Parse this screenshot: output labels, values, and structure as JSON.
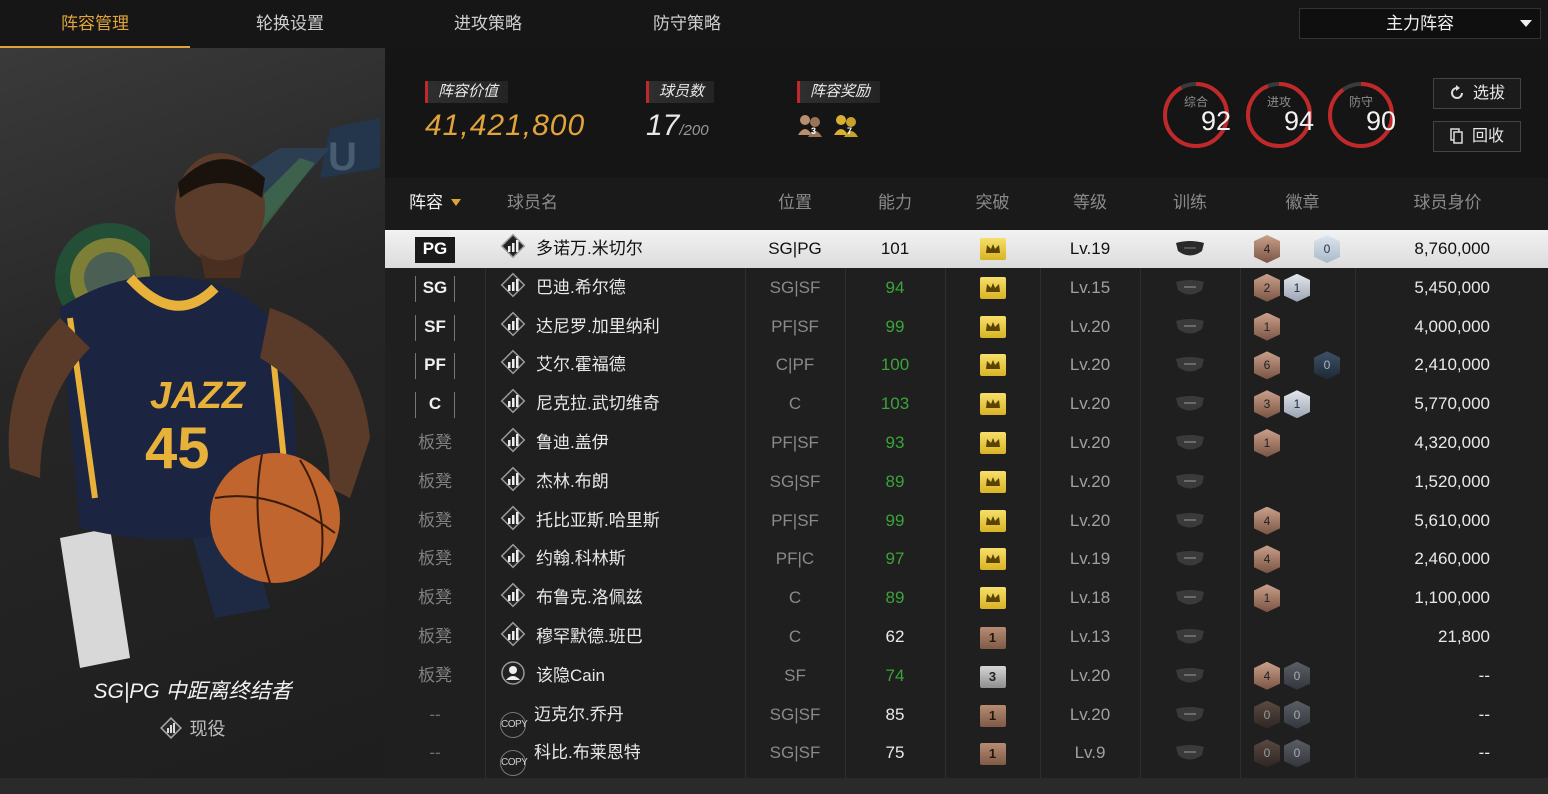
{
  "tabs": [
    {
      "label": "阵容管理",
      "active": true
    },
    {
      "label": "轮换设置",
      "active": false
    },
    {
      "label": "进攻策略",
      "active": false
    },
    {
      "label": "防守策略",
      "active": false
    }
  ],
  "lineup_select": {
    "value": "主力阵容"
  },
  "player_card": {
    "role": "SG|PG 中距离终结者",
    "status": "现役"
  },
  "summary": {
    "value_label": "阵容价值",
    "value": "41,421,800",
    "count_label": "球员数",
    "count": "17",
    "count_max": "/200",
    "reward_label": "阵容奖励",
    "reward_icons": [
      "3",
      "7"
    ]
  },
  "ratings": [
    {
      "label": "综合",
      "value": "92",
      "fraction": 0.92
    },
    {
      "label": "进攻",
      "value": "94",
      "fraction": 0.94
    },
    {
      "label": "防守",
      "value": "90",
      "fraction": 0.9
    }
  ],
  "buttons": {
    "select": "选拔",
    "recycle": "回收"
  },
  "columns": [
    "阵容",
    "球员名",
    "位置",
    "能力",
    "突破",
    "等级",
    "训练",
    "徽章",
    "球员身价"
  ],
  "rows": [
    {
      "slot": "PG",
      "slot_type": "starter",
      "icon": "chart",
      "name": "多诺万.米切尔",
      "pos": "SG|PG",
      "ability": "101",
      "ability_color": "white",
      "breakthrough": "",
      "brk_type": "gold",
      "level": "Lv.19",
      "badges": [
        {
          "v": "4",
          "t": "b-bronze"
        },
        {
          "v": "",
          "t": "gap"
        },
        {
          "v": "0",
          "t": "b-paleblue"
        }
      ],
      "value": "8,760,000",
      "selected": true
    },
    {
      "slot": "SG",
      "slot_type": "starter",
      "icon": "chart",
      "name": "巴迪.希尔德",
      "pos": "SG|SF",
      "ability": "94",
      "ability_color": "green",
      "breakthrough": "",
      "brk_type": "gold",
      "level": "Lv.15",
      "badges": [
        {
          "v": "2",
          "t": "b-bronze"
        },
        {
          "v": "1",
          "t": "b-silver"
        }
      ],
      "value": "5,450,000"
    },
    {
      "slot": "SF",
      "slot_type": "starter",
      "icon": "chart",
      "name": "达尼罗.加里纳利",
      "pos": "PF|SF",
      "ability": "99",
      "ability_color": "green",
      "breakthrough": "",
      "brk_type": "gold",
      "level": "Lv.20",
      "badges": [
        {
          "v": "1",
          "t": "b-bronze"
        }
      ],
      "value": "4,000,000"
    },
    {
      "slot": "PF",
      "slot_type": "starter",
      "icon": "chart",
      "name": "艾尔.霍福德",
      "pos": "C|PF",
      "ability": "100",
      "ability_color": "green",
      "breakthrough": "",
      "brk_type": "gold",
      "level": "Lv.20",
      "badges": [
        {
          "v": "6",
          "t": "b-bronze"
        },
        {
          "v": "",
          "t": "gap"
        },
        {
          "v": "0",
          "t": "b-blue"
        }
      ],
      "value": "2,410,000"
    },
    {
      "slot": "C",
      "slot_type": "starter",
      "icon": "chart",
      "name": "尼克拉.武切维奇",
      "pos": "C",
      "ability": "103",
      "ability_color": "green",
      "breakthrough": "",
      "brk_type": "gold",
      "level": "Lv.20",
      "badges": [
        {
          "v": "3",
          "t": "b-bronze"
        },
        {
          "v": "1",
          "t": "b-silver"
        }
      ],
      "value": "5,770,000"
    },
    {
      "slot": "板凳",
      "slot_type": "bench",
      "icon": "chart",
      "name": "鲁迪.盖伊",
      "pos": "PF|SF",
      "ability": "93",
      "ability_color": "green",
      "breakthrough": "",
      "brk_type": "gold",
      "level": "Lv.20",
      "badges": [
        {
          "v": "1",
          "t": "b-bronze"
        }
      ],
      "value": "4,320,000"
    },
    {
      "slot": "板凳",
      "slot_type": "bench",
      "icon": "chart",
      "name": "杰林.布朗",
      "pos": "SG|SF",
      "ability": "89",
      "ability_color": "green",
      "breakthrough": "",
      "brk_type": "gold",
      "level": "Lv.20",
      "badges": [],
      "value": "1,520,000"
    },
    {
      "slot": "板凳",
      "slot_type": "bench",
      "icon": "chart",
      "name": "托比亚斯.哈里斯",
      "pos": "PF|SF",
      "ability": "99",
      "ability_color": "green",
      "breakthrough": "",
      "brk_type": "gold",
      "level": "Lv.20",
      "badges": [
        {
          "v": "4",
          "t": "b-bronze"
        }
      ],
      "value": "5,610,000"
    },
    {
      "slot": "板凳",
      "slot_type": "bench",
      "icon": "chart",
      "name": "约翰.科林斯",
      "pos": "PF|C",
      "ability": "97",
      "ability_color": "green",
      "breakthrough": "",
      "brk_type": "gold",
      "level": "Lv.19",
      "badges": [
        {
          "v": "4",
          "t": "b-bronze"
        }
      ],
      "value": "2,460,000"
    },
    {
      "slot": "板凳",
      "slot_type": "bench",
      "icon": "chart",
      "name": "布鲁克.洛佩兹",
      "pos": "C",
      "ability": "89",
      "ability_color": "green",
      "breakthrough": "",
      "brk_type": "gold",
      "level": "Lv.18",
      "badges": [
        {
          "v": "1",
          "t": "b-bronze"
        }
      ],
      "value": "1,100,000"
    },
    {
      "slot": "板凳",
      "slot_type": "bench",
      "icon": "chart",
      "name": "穆罕默德.班巴",
      "pos": "C",
      "ability": "62",
      "ability_color": "white",
      "breakthrough": "1",
      "brk_type": "bronze",
      "level": "Lv.13",
      "badges": [],
      "value": "21,800"
    },
    {
      "slot": "板凳",
      "slot_type": "bench",
      "icon": "person",
      "name": "该隐Cain",
      "pos": "SF",
      "ability": "74",
      "ability_color": "green",
      "breakthrough": "3",
      "brk_type": "silver",
      "level": "Lv.20",
      "badges": [
        {
          "v": "4",
          "t": "b-bronze"
        },
        {
          "v": "0",
          "t": "b-grey"
        }
      ],
      "value": "--"
    },
    {
      "slot": "--",
      "slot_type": "none",
      "icon": "copy",
      "name": "迈克尔.乔丹",
      "pos": "SG|SF",
      "ability": "85",
      "ability_color": "white",
      "breakthrough": "1",
      "brk_type": "bronze",
      "level": "Lv.20",
      "badges": [
        {
          "v": "0",
          "t": "b-dark"
        },
        {
          "v": "0",
          "t": "b-grey"
        }
      ],
      "value": "--"
    },
    {
      "slot": "--",
      "slot_type": "none",
      "icon": "copy",
      "name": "科比.布莱恩特",
      "pos": "SG|SF",
      "ability": "75",
      "ability_color": "white",
      "breakthrough": "1",
      "brk_type": "bronze",
      "level": "Lv.9",
      "badges": [
        {
          "v": "0",
          "t": "b-dark"
        },
        {
          "v": "0",
          "t": "b-grey"
        }
      ],
      "value": "--"
    }
  ],
  "copy_label": "COPY",
  "colors": {
    "accent": "#e0a43a",
    "red": "#c0282a",
    "green": "#3aa33a"
  }
}
